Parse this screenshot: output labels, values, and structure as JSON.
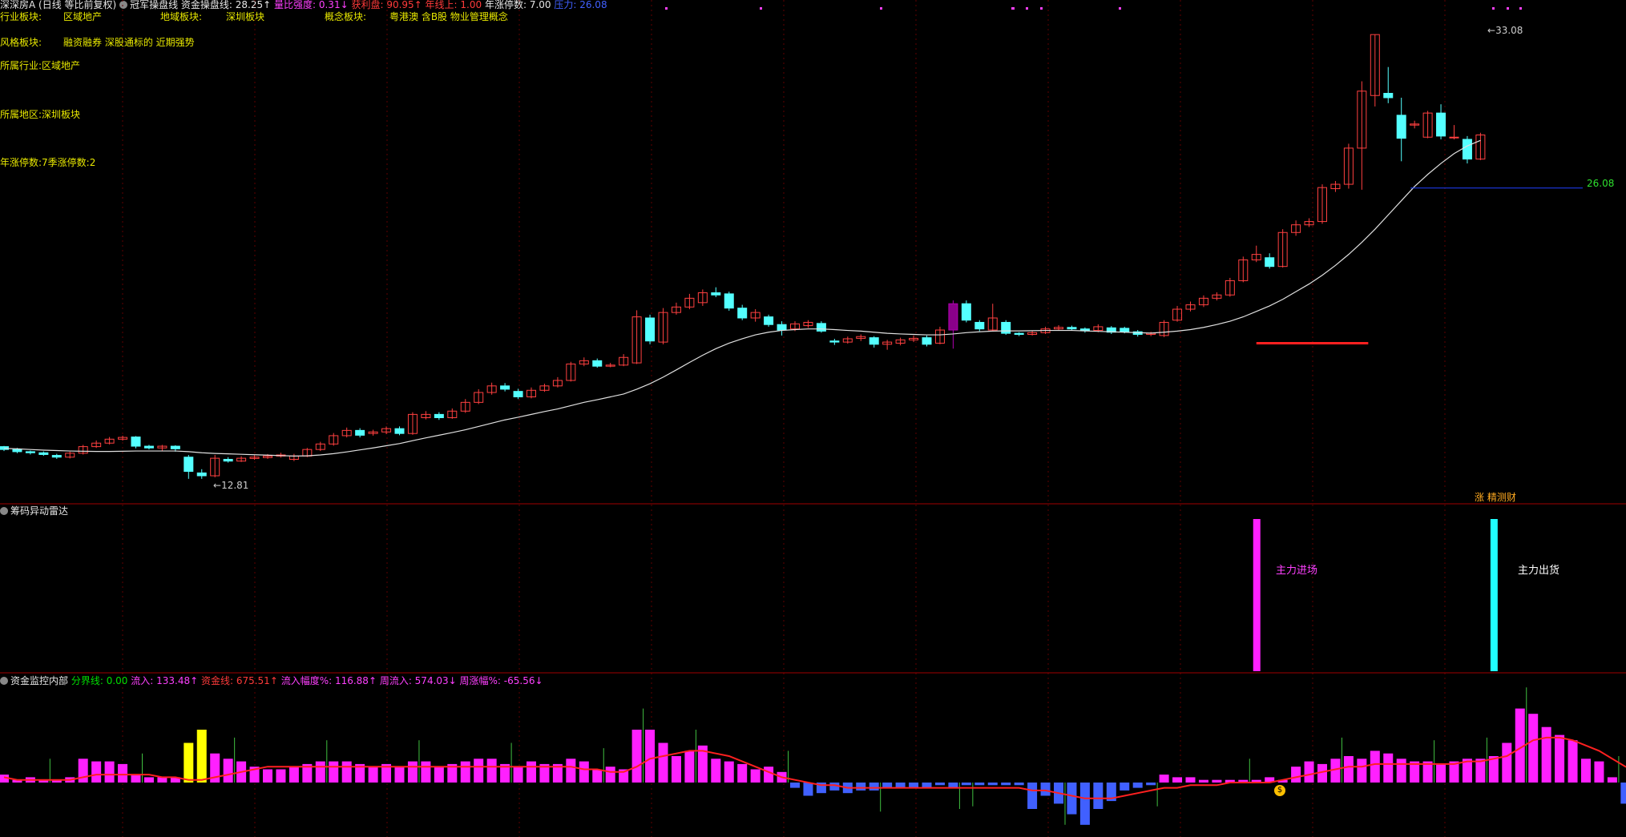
{
  "header": {
    "stock_name": "深深房A",
    "period_label": "(日线 等比前复权)",
    "indicator_name": "冠军操盘线",
    "items": [
      {
        "label": "资金操盘线:",
        "value": "28.25↑",
        "color": "#e6e6e6"
      },
      {
        "label": "量比强度:",
        "value": "0.31↓",
        "color": "#ff40ff"
      },
      {
        "label": "获利盘:",
        "value": "90.95↑",
        "color": "#ff3a3a"
      },
      {
        "label": "年线上:",
        "value": "1.00",
        "color": "#ff3a3a"
      },
      {
        "label": "年涨停数:",
        "value": "7.00",
        "color": "#e6e6e6"
      },
      {
        "label": "压力:",
        "value": "26.08",
        "color": "#4060ff"
      }
    ]
  },
  "info": {
    "industry_label": "行业板块:",
    "industry_value": "区域地产",
    "region_label": "地域板块:",
    "region_value": "深圳板块",
    "concept_label": "概念板块:",
    "concept_value": "粤港澳 含B股 物业管理概念",
    "style_label": "风格板块:",
    "style_value": "融资融券 深股通标的 近期强势",
    "belong_industry": "所属行业:区域地产",
    "belong_region": "所属地区:深圳板块",
    "limit_count": "年涨停数:7季涨停数:2"
  },
  "price_labels": {
    "high": "33.08",
    "low": "12.81",
    "pressure": "26.08",
    "corner_tag": "涨 精测财"
  },
  "radar_panel": {
    "title": "筹码异动雷达",
    "main_in": "主力进场",
    "main_out": "主力出货"
  },
  "fund_panel": {
    "title": "资金监控内部",
    "items": [
      {
        "label": "分界线:",
        "value": "0.00",
        "color": "#00e000"
      },
      {
        "label": "流入:",
        "value": "133.48↑",
        "color": "#ff40ff"
      },
      {
        "label": "资金线:",
        "value": "675.51↑",
        "color": "#ff3a3a"
      },
      {
        "label": "流入幅度%:",
        "value": "116.88↑",
        "color": "#ff40ff"
      },
      {
        "label": "周流入:",
        "value": "574.03↓",
        "color": "#ff40ff"
      },
      {
        "label": "周涨幅%:",
        "value": "-65.56↓",
        "color": "#ff40ff"
      }
    ],
    "marker": "$"
  },
  "chart_data": {
    "type": "candlestick",
    "ylim": [
      12.0,
      34.0
    ],
    "candles": [
      [
        14.28,
        14.15,
        14.31,
        14.08
      ],
      [
        14.15,
        14.05,
        14.22,
        13.98
      ],
      [
        14.05,
        14.0,
        14.1,
        13.92
      ],
      [
        14.0,
        13.92,
        14.06,
        13.86
      ],
      [
        13.88,
        13.8,
        13.95,
        13.72
      ],
      [
        13.8,
        13.98,
        14.05,
        13.74
      ],
      [
        13.98,
        14.28,
        14.36,
        13.92
      ],
      [
        14.28,
        14.44,
        14.56,
        14.22
      ],
      [
        14.44,
        14.62,
        14.72,
        14.38
      ],
      [
        14.62,
        14.7,
        14.78,
        14.55
      ],
      [
        14.72,
        14.3,
        14.76,
        14.2
      ],
      [
        14.3,
        14.22,
        14.36,
        14.15
      ],
      [
        14.22,
        14.3,
        14.36,
        14.1
      ],
      [
        14.3,
        14.18,
        14.34,
        14.05
      ],
      [
        13.8,
        13.15,
        13.9,
        12.81
      ],
      [
        13.08,
        12.95,
        13.25,
        12.81
      ],
      [
        12.95,
        13.75,
        13.9,
        12.88
      ],
      [
        13.7,
        13.62,
        13.8,
        13.55
      ],
      [
        13.62,
        13.75,
        13.84,
        13.58
      ],
      [
        13.74,
        13.8,
        13.88,
        13.68
      ],
      [
        13.78,
        13.85,
        13.94,
        13.72
      ],
      [
        13.85,
        13.9,
        14.0,
        13.78
      ],
      [
        13.7,
        13.85,
        13.95,
        13.62
      ],
      [
        13.85,
        14.15,
        14.22,
        13.8
      ],
      [
        14.15,
        14.4,
        14.5,
        14.08
      ],
      [
        14.4,
        14.78,
        14.9,
        14.32
      ],
      [
        14.78,
        15.02,
        15.15,
        14.7
      ],
      [
        15.02,
        14.8,
        15.12,
        14.7
      ],
      [
        14.88,
        14.95,
        15.05,
        14.78
      ],
      [
        14.95,
        15.1,
        15.2,
        14.85
      ],
      [
        15.1,
        14.88,
        15.2,
        14.8
      ],
      [
        14.88,
        15.75,
        15.85,
        14.82
      ],
      [
        15.6,
        15.75,
        15.9,
        15.52
      ],
      [
        15.75,
        15.6,
        15.85,
        15.5
      ],
      [
        15.6,
        15.9,
        16.02,
        15.55
      ],
      [
        15.9,
        16.3,
        16.45,
        15.82
      ],
      [
        16.3,
        16.75,
        16.9,
        16.22
      ],
      [
        16.75,
        17.05,
        17.2,
        16.65
      ],
      [
        17.05,
        16.9,
        17.18,
        16.8
      ],
      [
        16.8,
        16.55,
        16.92,
        16.45
      ],
      [
        16.55,
        16.85,
        16.98,
        16.48
      ],
      [
        16.85,
        17.05,
        17.15,
        16.78
      ],
      [
        17.05,
        17.3,
        17.45,
        16.98
      ],
      [
        17.3,
        18.05,
        18.15,
        17.25
      ],
      [
        18.05,
        18.2,
        18.35,
        17.95
      ],
      [
        18.2,
        17.95,
        18.3,
        17.88
      ],
      [
        17.95,
        18.0,
        18.1,
        17.9
      ],
      [
        18.0,
        18.35,
        18.5,
        17.95
      ],
      [
        18.1,
        20.2,
        20.5,
        18.05
      ],
      [
        20.15,
        19.1,
        20.3,
        18.95
      ],
      [
        19.05,
        20.4,
        20.6,
        18.95
      ],
      [
        20.4,
        20.65,
        20.85,
        20.3
      ],
      [
        20.65,
        21.05,
        21.25,
        20.55
      ],
      [
        20.85,
        21.3,
        21.45,
        20.7
      ],
      [
        21.3,
        21.2,
        21.55,
        21.1
      ],
      [
        21.25,
        20.6,
        21.35,
        20.48
      ],
      [
        20.6,
        20.15,
        20.75,
        20.05
      ],
      [
        20.15,
        20.4,
        20.55,
        19.98
      ],
      [
        20.2,
        19.85,
        20.3,
        19.75
      ],
      [
        19.85,
        19.6,
        20.0,
        19.35
      ],
      [
        19.65,
        19.88,
        20.0,
        19.55
      ],
      [
        19.8,
        19.95,
        20.05,
        19.7
      ],
      [
        19.9,
        19.55,
        20.0,
        19.48
      ],
      [
        19.1,
        19.05,
        19.2,
        18.92
      ],
      [
        19.05,
        19.2,
        19.3,
        18.98
      ],
      [
        19.22,
        19.3,
        19.4,
        19.1
      ],
      [
        19.25,
        18.95,
        19.32,
        18.8
      ],
      [
        18.95,
        19.05,
        19.15,
        18.7
      ],
      [
        19.0,
        19.15,
        19.25,
        18.9
      ],
      [
        19.15,
        19.22,
        19.35,
        19.05
      ],
      [
        19.25,
        18.95,
        19.35,
        18.85
      ],
      [
        19.0,
        19.6,
        19.75,
        18.95
      ],
      [
        19.6,
        20.8,
        20.95,
        18.75
      ],
      [
        20.8,
        20.05,
        20.95,
        19.95
      ],
      [
        19.95,
        19.65,
        20.05,
        19.55
      ],
      [
        19.6,
        20.15,
        20.8,
        19.55
      ],
      [
        19.95,
        19.45,
        20.05,
        19.38
      ],
      [
        19.45,
        19.4,
        19.5,
        19.32
      ],
      [
        19.4,
        19.48,
        19.56,
        19.35
      ],
      [
        19.48,
        19.65,
        19.75,
        19.42
      ],
      [
        19.65,
        19.72,
        19.82,
        19.58
      ],
      [
        19.72,
        19.65,
        19.8,
        19.58
      ],
      [
        19.65,
        19.58,
        19.72,
        19.48
      ],
      [
        19.58,
        19.75,
        19.86,
        19.5
      ],
      [
        19.7,
        19.5,
        19.78,
        19.42
      ],
      [
        19.68,
        19.52,
        19.75,
        19.45
      ],
      [
        19.52,
        19.4,
        19.6,
        19.3
      ],
      [
        19.4,
        19.45,
        19.52,
        19.32
      ],
      [
        19.35,
        19.95,
        20.05,
        19.28
      ],
      [
        20.05,
        20.55,
        20.7,
        19.98
      ],
      [
        20.55,
        20.75,
        20.9,
        20.45
      ],
      [
        20.75,
        21.05,
        21.18,
        20.65
      ],
      [
        21.05,
        21.2,
        21.32,
        20.95
      ],
      [
        21.2,
        21.85,
        21.98,
        21.12
      ],
      [
        21.85,
        22.8,
        22.95,
        21.78
      ],
      [
        22.8,
        23.05,
        23.45,
        22.7
      ],
      [
        22.9,
        22.5,
        23.1,
        22.4
      ],
      [
        22.5,
        24.05,
        24.2,
        22.45
      ],
      [
        24.05,
        24.4,
        24.6,
        23.9
      ],
      [
        24.4,
        24.55,
        24.7,
        24.3
      ],
      [
        24.55,
        26.1,
        26.25,
        24.45
      ],
      [
        26.05,
        26.25,
        26.4,
        25.9
      ],
      [
        26.25,
        27.9,
        28.1,
        26.05
      ],
      [
        27.9,
        30.5,
        30.95,
        26.0
      ],
      [
        30.3,
        33.08,
        33.08,
        29.8
      ],
      [
        30.4,
        30.2,
        31.6,
        29.95
      ],
      [
        29.4,
        28.35,
        30.2,
        27.3
      ],
      [
        28.95,
        29.0,
        29.15,
        28.8
      ],
      [
        28.4,
        29.5,
        29.6,
        28.35
      ],
      [
        29.5,
        28.45,
        29.9,
        28.3
      ],
      [
        28.4,
        28.4,
        28.95,
        28.3
      ],
      [
        28.3,
        27.4,
        28.45,
        27.2
      ],
      [
        27.4,
        28.5,
        28.6,
        27.35
      ]
    ],
    "ma_line": [
      14.2,
      14.18,
      14.15,
      14.12,
      14.1,
      14.08,
      14.07,
      14.06,
      14.06,
      14.07,
      14.08,
      14.08,
      14.08,
      14.08,
      14.05,
      14.0,
      13.97,
      13.95,
      13.93,
      13.91,
      13.89,
      13.87,
      13.85,
      13.86,
      13.9,
      13.96,
      14.04,
      14.13,
      14.22,
      14.32,
      14.42,
      14.55,
      14.68,
      14.8,
      14.92,
      15.05,
      15.2,
      15.35,
      15.5,
      15.62,
      15.75,
      15.88,
      16.0,
      16.15,
      16.3,
      16.42,
      16.55,
      16.68,
      16.9,
      17.15,
      17.45,
      17.78,
      18.12,
      18.45,
      18.75,
      19.0,
      19.2,
      19.38,
      19.5,
      19.58,
      19.62,
      19.65,
      19.65,
      19.62,
      19.58,
      19.55,
      19.5,
      19.45,
      19.42,
      19.4,
      19.38,
      19.38,
      19.42,
      19.48,
      19.52,
      19.55,
      19.56,
      19.56,
      19.57,
      19.58,
      19.58,
      19.58,
      19.56,
      19.54,
      19.52,
      19.5,
      19.48,
      19.46,
      19.5,
      19.55,
      19.62,
      19.72,
      19.85,
      20.0,
      20.2,
      20.45,
      20.7,
      21.0,
      21.35,
      21.7,
      22.1,
      22.55,
      23.05,
      23.6,
      24.2,
      24.85,
      25.5,
      26.15,
      26.7,
      27.2,
      27.65,
      28.0,
      28.25
    ],
    "volume": [
      0.3,
      0.1,
      0.2,
      0.1,
      0.1,
      0.2,
      0.9,
      0.8,
      0.8,
      0.7,
      0.3,
      0.2,
      0.2,
      0.2,
      1.5,
      2.0,
      1.1,
      0.9,
      0.8,
      0.6,
      0.5,
      0.5,
      0.6,
      0.7,
      0.8,
      0.8,
      0.8,
      0.7,
      0.6,
      0.7,
      0.6,
      0.8,
      0.8,
      0.6,
      0.7,
      0.8,
      0.9,
      0.9,
      0.7,
      0.6,
      0.8,
      0.7,
      0.7,
      0.9,
      0.8,
      0.5,
      0.6,
      0.5,
      2.0,
      2.0,
      1.5,
      1.0,
      1.2,
      1.4,
      0.9,
      0.8,
      0.7,
      0.5,
      0.6,
      0.4,
      -0.2,
      -0.5,
      -0.4,
      -0.3,
      -0.4,
      -0.3,
      -0.3,
      -0.2,
      -0.2,
      -0.2,
      -0.2,
      -0.1,
      -0.2,
      -0.1,
      -0.1,
      -0.1,
      -0.1,
      -0.1,
      -1.0,
      -0.5,
      -0.8,
      -1.2,
      -1.6,
      -1.0,
      -0.7,
      -0.3,
      -0.2,
      -0.1,
      0.3,
      0.2,
      0.2,
      0.1,
      0.1,
      0.1,
      0.1,
      0.1,
      0.2,
      0.1,
      0.6,
      0.8,
      0.7,
      0.9,
      1.0,
      0.9,
      1.2,
      1.1,
      0.9,
      0.8,
      0.8,
      0.7,
      0.8,
      0.9,
      0.9,
      1.0,
      1.5,
      2.8,
      2.6,
      2.1,
      1.8,
      1.6,
      0.9,
      0.8,
      0.2,
      -0.8,
      0.2
    ],
    "fund_line": [
      0.2,
      0.1,
      0.1,
      0.1,
      0.1,
      0.1,
      0.2,
      0.3,
      0.3,
      0.3,
      0.3,
      0.3,
      0.2,
      0.2,
      0.1,
      0.1,
      0.2,
      0.3,
      0.4,
      0.5,
      0.6,
      0.6,
      0.6,
      0.6,
      0.6,
      0.6,
      0.6,
      0.6,
      0.6,
      0.6,
      0.6,
      0.6,
      0.6,
      0.6,
      0.6,
      0.6,
      0.6,
      0.6,
      0.6,
      0.6,
      0.6,
      0.6,
      0.6,
      0.6,
      0.5,
      0.5,
      0.4,
      0.4,
      0.6,
      0.9,
      1.0,
      1.1,
      1.2,
      1.2,
      1.1,
      1.0,
      0.8,
      0.6,
      0.4,
      0.2,
      0.1,
      0.0,
      -0.1,
      -0.1,
      -0.2,
      -0.2,
      -0.2,
      -0.2,
      -0.2,
      -0.2,
      -0.2,
      -0.2,
      -0.2,
      -0.2,
      -0.2,
      -0.2,
      -0.2,
      -0.2,
      -0.3,
      -0.3,
      -0.4,
      -0.5,
      -0.6,
      -0.6,
      -0.6,
      -0.5,
      -0.4,
      -0.3,
      -0.2,
      -0.2,
      -0.1,
      -0.1,
      -0.1,
      0.0,
      0.0,
      0.0,
      0.0,
      0.1,
      0.2,
      0.3,
      0.4,
      0.5,
      0.6,
      0.6,
      0.7,
      0.7,
      0.7,
      0.7,
      0.7,
      0.7,
      0.7,
      0.8,
      0.8,
      0.9,
      1.0,
      1.3,
      1.6,
      1.7,
      1.7,
      1.6,
      1.4,
      1.2,
      0.9,
      0.6,
      0.5
    ],
    "highlights": {
      "yellow_volume_bars": [
        14,
        15
      ],
      "purple_candle": 72,
      "main_in_index": 95,
      "main_out_index": 113
    }
  }
}
